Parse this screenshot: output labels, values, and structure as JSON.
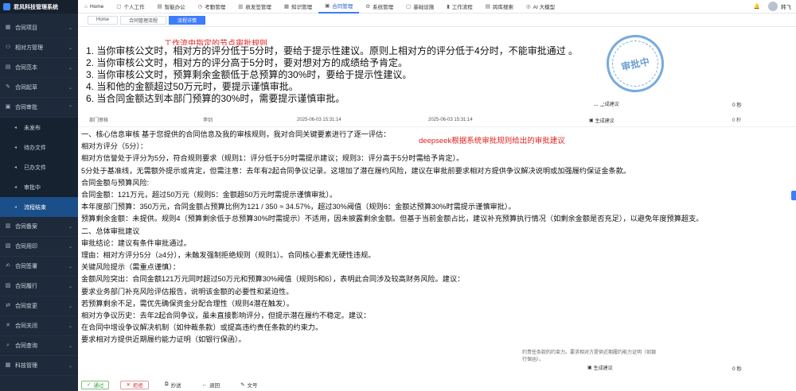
{
  "app": {
    "title": "君风科技管理系统"
  },
  "sidebar": {
    "items": [
      {
        "label": "合同项目",
        "icon": "folder-icon"
      },
      {
        "label": "相对方管理",
        "icon": "users-icon"
      },
      {
        "label": "合同范本",
        "icon": "file-icon"
      },
      {
        "label": "合同起草",
        "icon": "edit-icon"
      },
      {
        "label": "合同审批",
        "icon": "check-icon"
      }
    ],
    "subitems": [
      {
        "label": "未发布"
      },
      {
        "label": "待办文件"
      },
      {
        "label": "已办文件"
      },
      {
        "label": "审批中"
      },
      {
        "label": "流程结束"
      }
    ],
    "items2": [
      {
        "label": "合同备案"
      },
      {
        "label": "合同用印"
      },
      {
        "label": "合同签署"
      },
      {
        "label": "合同履行"
      },
      {
        "label": "合同变更"
      },
      {
        "label": "合同关闭"
      },
      {
        "label": "合同查询"
      },
      {
        "label": "科技管理"
      }
    ]
  },
  "topnav": [
    {
      "label": "Home",
      "icon": "home-icon"
    },
    {
      "label": "个人工作",
      "icon": "person-icon"
    },
    {
      "label": "智能办公",
      "icon": "office-icon"
    },
    {
      "label": "考勤管理",
      "icon": "clock-icon"
    },
    {
      "label": "收发签管理",
      "icon": "inbox-icon"
    },
    {
      "label": "知识管理",
      "icon": "book-icon"
    },
    {
      "label": "合同管理",
      "icon": "contract-icon"
    },
    {
      "label": "系统管理",
      "icon": "gear-icon"
    },
    {
      "label": "基础设施",
      "icon": "server-icon"
    },
    {
      "label": "工作流程",
      "icon": "flow-icon"
    },
    {
      "label": "跨库搜索",
      "icon": "search-icon"
    },
    {
      "label": "AI 大模型",
      "icon": "ai-icon"
    }
  ],
  "user": {
    "name": "韩飞"
  },
  "tabs": [
    {
      "label": "Home"
    },
    {
      "label": "合同管理流程"
    },
    {
      "label": "流程详情"
    }
  ],
  "rules": {
    "heading": "工作流中指定的节点审批规则",
    "lines": [
      "1. 当你审核公文时，相对方的评分低于5分时，要给于提示性建议。原则上相对方的评分低于4分时，不能审批通过 。",
      "2. 当你审核公文时，相对方的评分高于5分时，要对想对方的成绩给予肯定。",
      "3. 当你审核公文时，预算剩余金额低于总预算的30%时，要给于提示性建议。",
      "4. 当和他的金额超过50万元时，要提示谨慎审批。",
      "6. 当合同金额达到本部门预算的30%时，需要提示谨慎审批。"
    ]
  },
  "form": {
    "gen1": "生成建议",
    "sec1": "0 秒",
    "dept": "部门审核",
    "person": "李剑",
    "time1": "2025-06-03 15:31:14",
    "time2": "2025-06-03 15:31:14",
    "gen2": "生成建议",
    "sec2": "0 秒"
  },
  "ai_label": "deepseek根据系统审批规则给出的审批建议",
  "analysis": [
    "一、核心信息审核 基于您提供的合同信息及我的审核规则，我对合同关键要素进行了逐一评估：",
    "相对方评分（5分）：",
    "相对方信誉处于评分为5分，符合规则要求（规则1：评分低于5分时需提示建议；规则3：评分高于5分时需给予肯定）。",
    "5分处于基准线，无需额外提示或肯定，但需注意：去年有2起合同争议记录。这增加了潜在履约风险，建议在审批前要求相对方提供争议解决说明或加强履约保证金条款。",
    "合同金额与预算风险:",
    "合同金额：121万元，超过50万元（规则5：金额超50万元时需提示谨慎审批）。",
    "本年度部门预算：350万元，合同金额占预算比例为121 / 350 ≈ 34.57%，超过30%阈值（规则6：金额达预算30%时需提示谨慎审批）。",
    "预算剩余金额：未提供。规则4（预算剩余低于总预算30%时需提示）不适用，因未披露剩余金额。但基于当前金额占比，建议补充预算执行情况（如剩余金额是否充足），以避免年度预算超支。",
    "二、总体审批建议",
    "审批结论：建议有条件审批通过。",
    "理由：相对方评分5分（≥4分），未触发强制拒绝规则（规则1）。合同核心要素无硬性违规。",
    "关键风险提示（需重点谨慎）：",
    "金额风险突出：合同金额121万元同时超过50万元和预算30%阈值（规则5和6），表明此合同涉及较高财务风险。建议：",
    "要求业务部门补充风险评估报告，说明该金额的必要性和紧迫性。",
    "若预算剩余不足，需优先确保资金分配合理性（规则4潜在触发）。",
    "相对方争议历史：去年2起合同争议，虽未直接影响评分，但提示潜在履约不稳定。建议：",
    "在合同中增设争议解决机制（如仲裁条款）或提高违约责任条款的约束力。",
    "要求相对方提供近期履约能力证明（如银行保函）。"
  ],
  "bottom_right": {
    "text1": "约责任条款的约束力。要求相对方提供近期履约能力证明（如银",
    "text2": "行保函）。",
    "gen3": "生成建议",
    "sec3": "0 秒"
  },
  "seal": {
    "text": "审批中"
  },
  "buttons": {
    "approve": "通过",
    "reject": "拒绝",
    "cc": "抄送",
    "back": "退回",
    "doc": "文号"
  }
}
